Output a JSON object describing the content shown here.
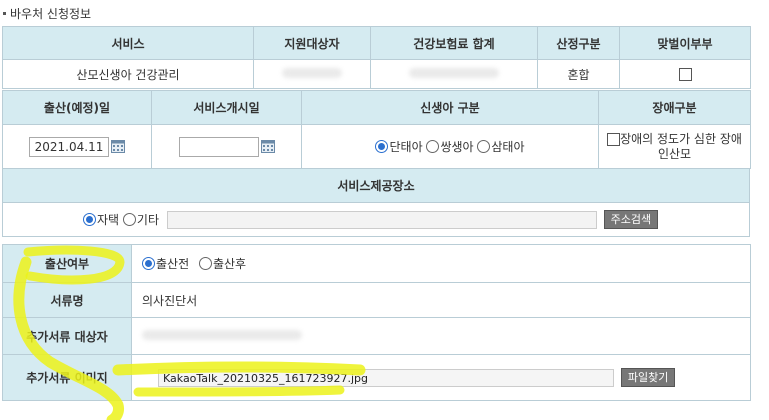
{
  "section_title": "바우처 신청정보",
  "top_table": {
    "headers": [
      "서비스",
      "지원대상자",
      "건강보험료 합계",
      "산정구분",
      "맞벌이부부"
    ],
    "service": "산모신생아 건강관리",
    "calc_type": "혼합"
  },
  "mid_table": {
    "headers": [
      "출산(예정)일",
      "서비스개시일",
      "신생아 구분",
      "장애구분"
    ],
    "birth_date": "2021.04.11",
    "baby_options": [
      "단태아",
      "쌍생아",
      "삼태아"
    ],
    "disability_label": "장애의 정도가 심한 장애인산모"
  },
  "place": {
    "header": "서비스제공장소",
    "options": [
      "자택",
      "기타"
    ],
    "search_button": "주소검색"
  },
  "bottom": {
    "birth_status_label": "출산여부",
    "birth_status_options": [
      "출산전",
      "출산후"
    ],
    "doc_name_label": "서류명",
    "doc_name_value": "의사진단서",
    "extra_target_label": "추가서류 대상자",
    "extra_image_label": "추가서류 이미지",
    "file_name": "KakaoTalk_20210325_161723927.jpg",
    "file_button": "파일찾기"
  },
  "colors": {
    "header_bg": "#d5ebf1",
    "border": "#b9cdd6",
    "highlight": "#ecf21a",
    "radio_on": "#2a6fcf"
  }
}
